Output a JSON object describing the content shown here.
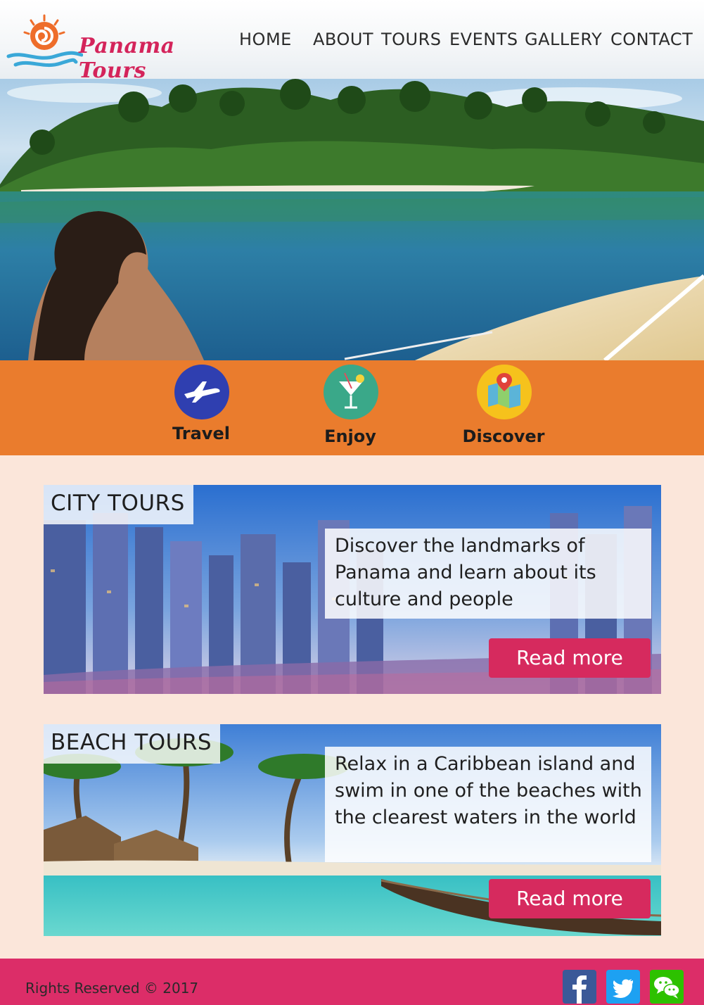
{
  "brand": {
    "name": "Panama Tours",
    "color": "#d4245b"
  },
  "nav": {
    "items": [
      "HOME",
      "ABOUT",
      "TOURS",
      "EVENTS",
      "GALLERY",
      "CONTACT"
    ]
  },
  "features": [
    {
      "label": "Travel",
      "icon": "airplane-icon",
      "color": "#2f3fb0"
    },
    {
      "label": "Enjoy",
      "icon": "cocktail-icon",
      "color": "#3aa889"
    },
    {
      "label": "Discover",
      "icon": "map-pin-icon",
      "color": "#f6c21c"
    }
  ],
  "tours": [
    {
      "title": "CITY TOURS",
      "description": "Discover the landmarks of Panama and learn about its culture and people",
      "button": "Read more"
    },
    {
      "title": "BEACH TOURS",
      "description": "Relax in a Caribbean island and swim in one of the beaches with the clearest waters in the world",
      "button": "Read more"
    }
  ],
  "footer": {
    "copyright": "Rights Reserved © 2017",
    "social": [
      {
        "icon": "facebook-icon",
        "color": "#3b5998"
      },
      {
        "icon": "twitter-icon",
        "color": "#1da1f2"
      },
      {
        "icon": "wechat-icon",
        "color": "#2dc100"
      }
    ]
  },
  "colors": {
    "accent_orange": "#ea7c2d",
    "accent_pink": "#dc2d68",
    "page_bg": "#fbe6da"
  }
}
